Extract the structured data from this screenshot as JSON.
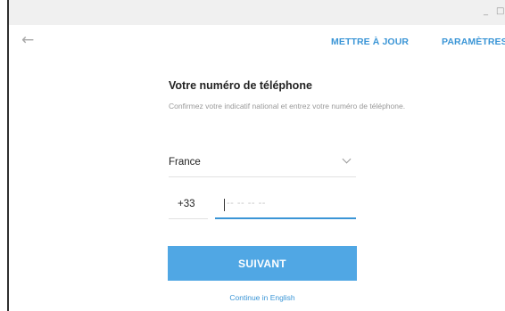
{
  "window": {
    "controls": {
      "minimize": "_",
      "maximize": "□"
    }
  },
  "header": {
    "back_icon": "arrow-left-icon",
    "update_link": "METTRE À JOUR",
    "settings_link": "PARAMÈTRES"
  },
  "form": {
    "title": "Votre numéro de téléphone",
    "subtitle": "Confirmez votre indicatif national et entrez votre numéro de téléphone.",
    "country": {
      "value": "France",
      "icon": "chevron-down-icon"
    },
    "country_code": "+33",
    "phone": {
      "value": "",
      "placeholder": "-- -- -- --"
    },
    "submit_label": "SUIVANT",
    "continue_link": "Continue in English"
  },
  "colors": {
    "accent": "#3a95d6",
    "button": "#50a7e4",
    "titlebar": "#f0f0f0"
  }
}
